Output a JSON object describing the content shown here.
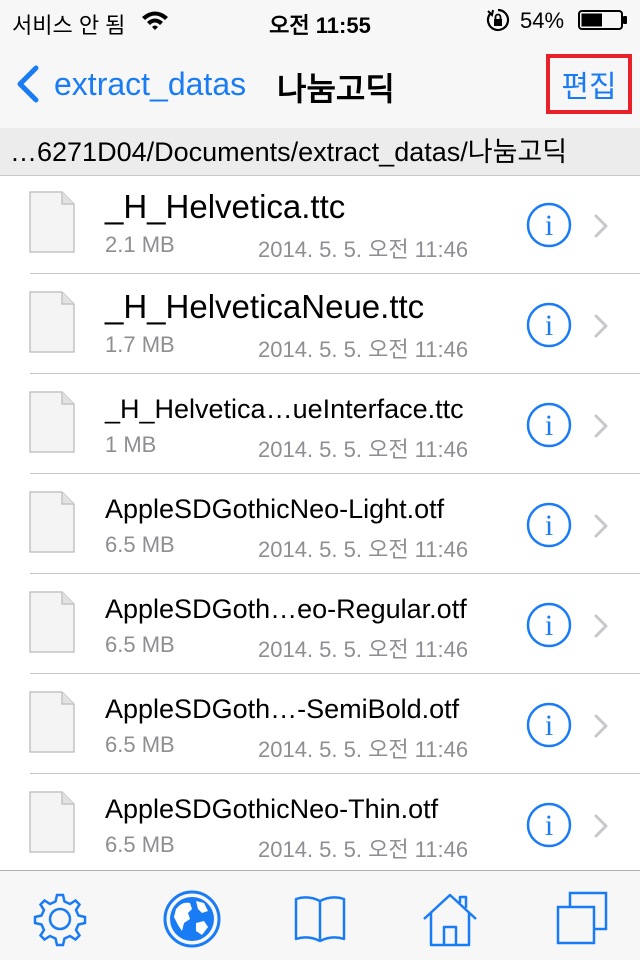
{
  "status_bar": {
    "carrier": "서비스 안 됨",
    "time": "오전 11:55",
    "battery": "54%",
    "battery_level": 0.54,
    "icons": [
      "wifi-icon",
      "rotation-lock-icon",
      "battery-icon"
    ]
  },
  "nav": {
    "back_label": "extract_datas",
    "title": "나눔고딕",
    "edit_label": "편집",
    "accent_color": "#1a7cf5",
    "highlight_color": "#e8202a"
  },
  "path": "…6271D04/Documents/extract_datas/나눔고딕",
  "files": [
    {
      "name": "_H_Helvetica.ttc",
      "size": "2.1 MB",
      "date": "2014. 5. 5. 오전 11:46"
    },
    {
      "name": "_H_HelveticaNeue.ttc",
      "size": "1.7 MB",
      "date": "2014. 5. 5. 오전 11:46"
    },
    {
      "name": "_H_Helvetica…ueInterface.ttc",
      "size": "1 MB",
      "date": "2014. 5. 5. 오전 11:46"
    },
    {
      "name": "AppleSDGothicNeo-Light.otf",
      "size": "6.5 MB",
      "date": "2014. 5. 5. 오전 11:46"
    },
    {
      "name": "AppleSDGoth…eo-Regular.otf",
      "size": "6.5 MB",
      "date": "2014. 5. 5. 오전 11:46"
    },
    {
      "name": "AppleSDGoth…-SemiBold.otf",
      "size": "6.5 MB",
      "date": "2014. 5. 5. 오전 11:46"
    },
    {
      "name": "AppleSDGothicNeo-Thin.otf",
      "size": "6.5 MB",
      "date": "2014. 5. 5. 오전 11:46"
    }
  ],
  "tab_bar": {
    "icons": [
      "gear-icon",
      "globe-icon",
      "book-icon",
      "home-icon",
      "copy-windows-icon"
    ]
  }
}
